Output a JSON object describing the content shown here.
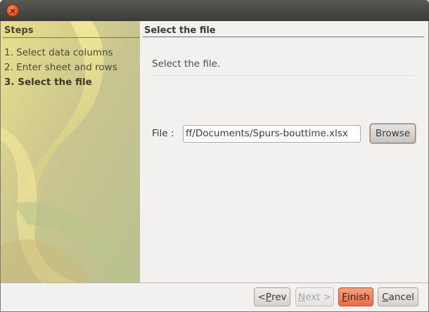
{
  "window": {
    "close_glyph": "×"
  },
  "sidebar": {
    "title": "Steps",
    "steps": [
      {
        "label": "1. Select data columns",
        "current": false
      },
      {
        "label": "2. Enter sheet and rows",
        "current": false
      },
      {
        "label": "3. Select the file",
        "current": true
      }
    ]
  },
  "main": {
    "title": "Select the file",
    "instruction": "Select the file.",
    "file_label": "File :",
    "file_value": "ff/Documents/Spurs-bouttime.xlsx",
    "browse_label": "Browse"
  },
  "buttons": {
    "prev": {
      "mnemonic": "P",
      "rest": "rev",
      "prefix": "< "
    },
    "next": {
      "mnemonic": "N",
      "rest": "ext >"
    },
    "finish": {
      "mnemonic": "F",
      "rest": "inish"
    },
    "cancel": {
      "mnemonic": "C",
      "rest": "ancel"
    }
  },
  "colors": {
    "accent": "#e96c44",
    "sidebar": "#c9c38f"
  },
  "icons": {
    "close": "close-icon"
  }
}
